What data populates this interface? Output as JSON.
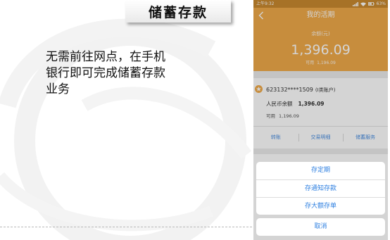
{
  "slide": {
    "title": "储蓄存款",
    "body": "无需前往网点，在手机银行即可完成储蓄存款业务",
    "watermark_icon": "bank-logo-watermark"
  },
  "phone": {
    "status": {
      "time": "上午9:32",
      "icons": [
        "signal-icon",
        "wifi-icon",
        "battery-icon"
      ],
      "battery": "63%"
    },
    "header": {
      "back_icon": "chevron-left-icon",
      "title": "我的活期"
    },
    "balance": {
      "label": "余额(元)",
      "amount": "1,396.09",
      "available_label": "可用",
      "available_amount": "1,196.09"
    },
    "account_card": {
      "icon": "account-badge-icon",
      "account": "623132****1509",
      "account_type": "(I类账户)",
      "currency_label": "人民币余额",
      "currency_amount": "1,396.09",
      "available_label": "可用",
      "available_amount": "1,196.09",
      "actions": [
        "转账",
        "交易明细",
        "储蓄服务"
      ]
    },
    "action_sheet": {
      "options": [
        "存定期",
        "存通知存款",
        "存大额存单"
      ],
      "cancel": "取消"
    }
  },
  "colors": {
    "accent_orange": "#f0aa4a",
    "status_bar": "#c98a30",
    "link_blue": "#4a8ee0",
    "sheet_blue": "#2d7fe0"
  }
}
